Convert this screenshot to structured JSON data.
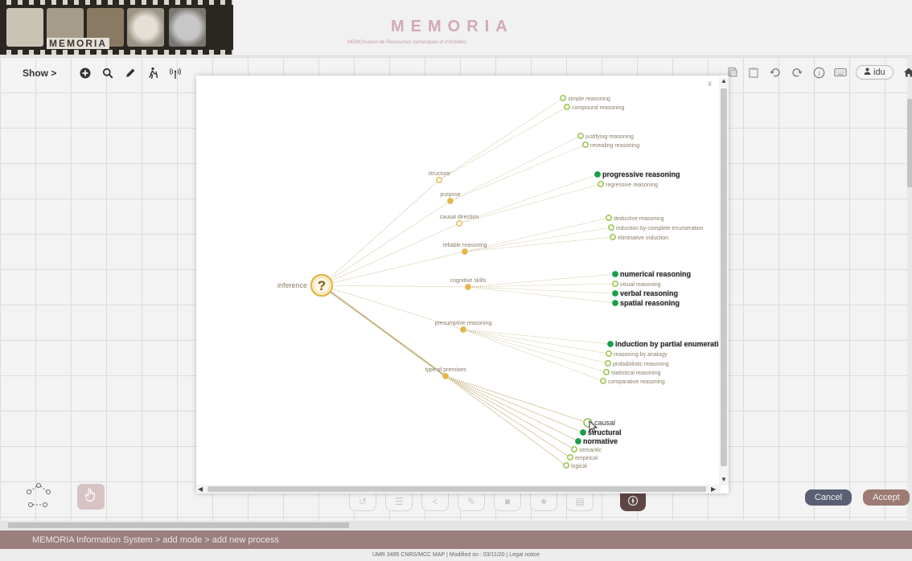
{
  "header": {
    "logo_text": "MEMORIA",
    "title": "MEMORIA",
    "subtitle": "MEMOrisation de Ressources numériques et d'Activités"
  },
  "toolbar": {
    "show_label": "Show >",
    "icons": [
      "add-circle-icon",
      "search-icon",
      "pencil-icon",
      "walker-icon",
      "antenna-icon"
    ]
  },
  "right_tools": {
    "icons": [
      "copy-icon",
      "paste-icon",
      "undo-icon",
      "redo-icon",
      "info-icon",
      "keyboard-icon"
    ],
    "user_label": "idu"
  },
  "modal": {
    "close_label": "x",
    "tree": {
      "root": {
        "label": "inference",
        "icon": "?"
      },
      "groups": [
        {
          "label": "structure",
          "leaves": [
            {
              "label": "simple reasoning",
              "selected": false
            },
            {
              "label": "compound reasoning",
              "selected": false
            }
          ]
        },
        {
          "label": "purpose",
          "leaves": [
            {
              "label": "justifying reasoning",
              "selected": false
            },
            {
              "label": "revealing reasoning",
              "selected": false
            }
          ]
        },
        {
          "label": "causal direction",
          "leaves": [
            {
              "label": "progressive reasoning",
              "selected": true
            },
            {
              "label": "regressive reasoning",
              "selected": false
            }
          ]
        },
        {
          "label": "reliable reasoning",
          "leaves": [
            {
              "label": "deductive reasoning",
              "selected": false
            },
            {
              "label": "induction by complete enumeration",
              "selected": false
            },
            {
              "label": "eliminative induction",
              "selected": false
            }
          ]
        },
        {
          "label": "cognitive skills",
          "leaves": [
            {
              "label": "numerical reasoning",
              "selected": true
            },
            {
              "label": "visual reasoning",
              "selected": false
            },
            {
              "label": "verbal reasoning",
              "selected": true
            },
            {
              "label": "spatial reasoning",
              "selected": true
            }
          ]
        },
        {
          "label": "presumptive reasoning",
          "leaves": [
            {
              "label": "induction by partial enumeratio",
              "selected": true
            },
            {
              "label": "reasoning by analogy",
              "selected": false
            },
            {
              "label": "probabilistic reasoning",
              "selected": false
            },
            {
              "label": "statistical reasoning",
              "selected": false
            },
            {
              "label": "comparative reasoning",
              "selected": false
            }
          ]
        },
        {
          "label": "type of premises",
          "leaves": [
            {
              "label": "causal",
              "selected": false,
              "hover": true
            },
            {
              "label": "structural",
              "selected": true
            },
            {
              "label": "normative",
              "selected": true
            },
            {
              "label": "semantic",
              "selected": false
            },
            {
              "label": "empirical",
              "selected": false
            },
            {
              "label": "logical",
              "selected": false
            }
          ]
        }
      ]
    }
  },
  "bottom": {
    "cancel_label": "Cancel",
    "accept_label": "Accept"
  },
  "breadcrumb": "MEMORIA  Information System  >  add mode > add new process",
  "footer": "UMR 3495 CNRS/MCC MAP   |   Modified on : 03/11/20   |   Legal notice",
  "colors": {
    "node": "#e3b84a",
    "leaf_open": "#8fbf3a",
    "leaf_selected": "#1a9e4a",
    "line": "#c9b98a",
    "breadcrumb_bg": "#9a7f7e",
    "cancel_bg": "#5a5f73",
    "accept_bg": "#9e7a74"
  }
}
